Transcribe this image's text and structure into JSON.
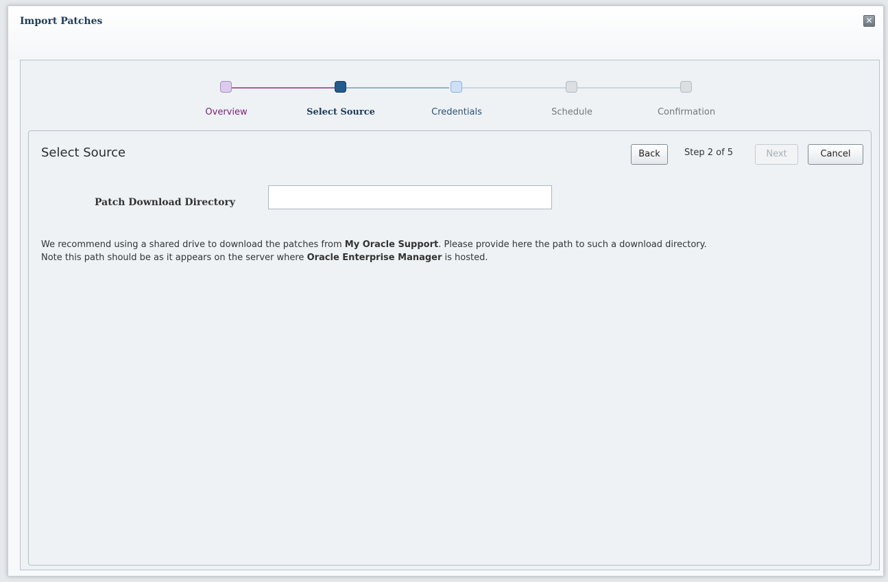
{
  "dialog": {
    "title": "Import Patches",
    "close_icon": "close-icon"
  },
  "train": {
    "stops": [
      {
        "label": "Overview",
        "state": "visited",
        "color": "#7a1e7a",
        "fill": "#d9c6ea",
        "border": "#a98cc5"
      },
      {
        "label": "Select Source",
        "state": "current",
        "color": "#1f3b5a",
        "fill": "#2a5c8a",
        "border": "#1d4a73"
      },
      {
        "label": "Credentials",
        "state": "next",
        "color": "#2a4f7a",
        "fill": "#cfe0f6",
        "border": "#8fb0d8"
      },
      {
        "label": "Schedule",
        "state": "unvisited",
        "color": "#777777",
        "fill": "#dcdfe2",
        "border": "#b5babf"
      },
      {
        "label": "Confirmation",
        "state": "unvisited",
        "color": "#777777",
        "fill": "#dcdfe2",
        "border": "#b5babf"
      }
    ]
  },
  "panel": {
    "title": "Select Source",
    "back_label": "Back",
    "step_text": "Step 2 of 5",
    "next_label": "Next",
    "cancel_label": "Cancel"
  },
  "form": {
    "directory_label": "Patch Download Directory",
    "directory_value": ""
  },
  "help": {
    "line1_pre": "We recommend using a shared drive to download the patches from ",
    "line1_bold": "My Oracle Support",
    "line1_post": ". Please provide here the path to such a download directory.",
    "line2_pre": "Note this path should be as it appears on the server where ",
    "line2_bold": "Oracle Enterprise Manager",
    "line2_post": " is hosted."
  }
}
